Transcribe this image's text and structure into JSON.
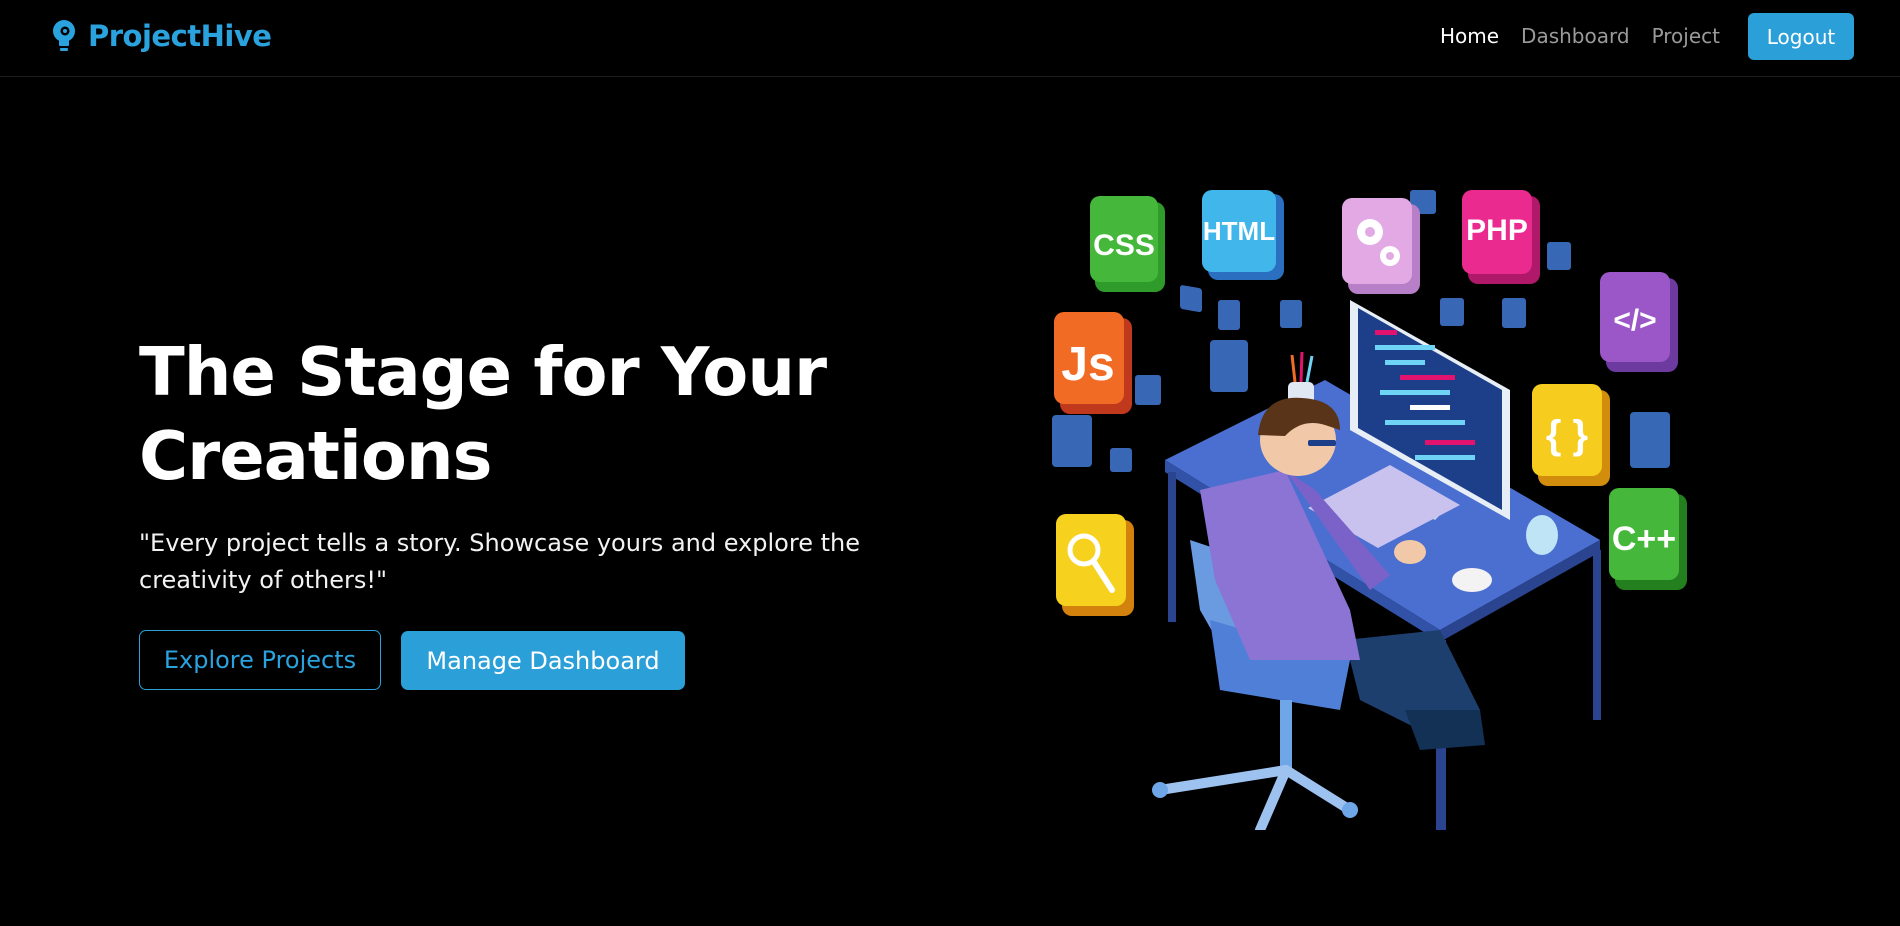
{
  "nav": {
    "brand": "ProjectHive",
    "links": [
      {
        "label": "Home",
        "active": true
      },
      {
        "label": "Dashboard",
        "active": false
      },
      {
        "label": "Project",
        "active": false
      }
    ],
    "logout_label": "Logout"
  },
  "hero": {
    "title": "The Stage for Your Creations",
    "subtitle": "\"Every project tells a story. Showcase yours and explore the creativity of others!\"",
    "explore_label": "Explore Projects",
    "manage_label": "Manage Dashboard"
  },
  "illustration": {
    "tiles": [
      "CSS",
      "HTML",
      "PHP",
      "Js",
      "</>",
      "{ }",
      "C++"
    ],
    "icons": [
      "gears-icon",
      "magnifier-icon"
    ]
  },
  "colors": {
    "accent": "#2a9fd8",
    "background": "#000000",
    "brand_text": "#2aa2dd"
  }
}
